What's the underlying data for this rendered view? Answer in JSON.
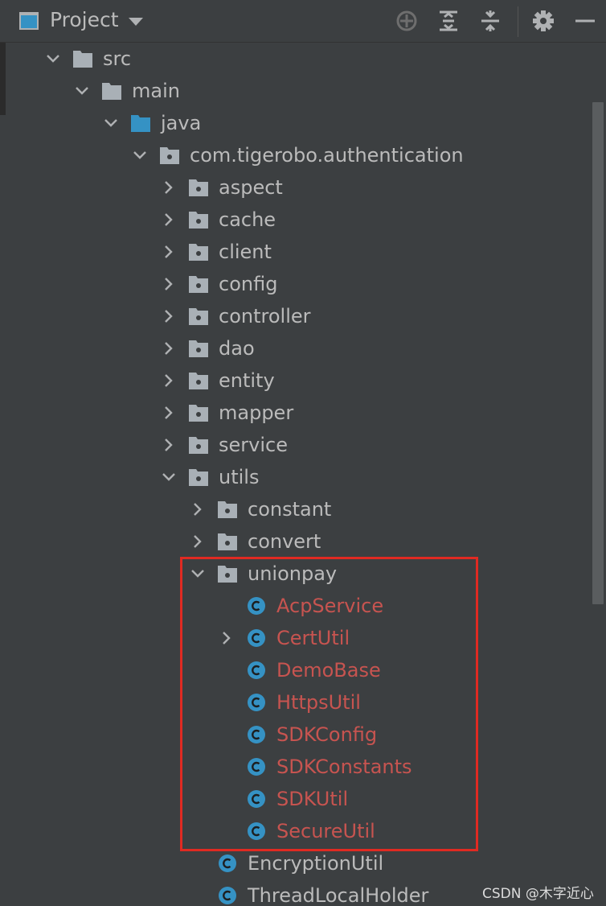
{
  "header": {
    "title": "Project",
    "icons": [
      "project-icon",
      "dropdown-icon",
      "locate-icon",
      "expand-all-icon",
      "collapse-all-icon",
      "gear-icon",
      "minimize-icon"
    ]
  },
  "tree": [
    {
      "label": "src",
      "depth": 0,
      "kind": "folder-gray",
      "arrow": "down"
    },
    {
      "label": "main",
      "depth": 1,
      "kind": "folder-gray",
      "arrow": "down"
    },
    {
      "label": "java",
      "depth": 2,
      "kind": "folder-blue",
      "arrow": "down"
    },
    {
      "label": "com.tigerobo.authentication",
      "depth": 3,
      "kind": "package",
      "arrow": "down"
    },
    {
      "label": "aspect",
      "depth": 4,
      "kind": "package",
      "arrow": "right"
    },
    {
      "label": "cache",
      "depth": 4,
      "kind": "package",
      "arrow": "right"
    },
    {
      "label": "client",
      "depth": 4,
      "kind": "package",
      "arrow": "right"
    },
    {
      "label": "config",
      "depth": 4,
      "kind": "package",
      "arrow": "right"
    },
    {
      "label": "controller",
      "depth": 4,
      "kind": "package",
      "arrow": "right"
    },
    {
      "label": "dao",
      "depth": 4,
      "kind": "package",
      "arrow": "right"
    },
    {
      "label": "entity",
      "depth": 4,
      "kind": "package",
      "arrow": "right"
    },
    {
      "label": "mapper",
      "depth": 4,
      "kind": "package",
      "arrow": "right"
    },
    {
      "label": "service",
      "depth": 4,
      "kind": "package",
      "arrow": "right"
    },
    {
      "label": "utils",
      "depth": 4,
      "kind": "package",
      "arrow": "down"
    },
    {
      "label": "constant",
      "depth": 5,
      "kind": "package",
      "arrow": "right"
    },
    {
      "label": "convert",
      "depth": 5,
      "kind": "package",
      "arrow": "right"
    },
    {
      "label": "unionpay",
      "depth": 5,
      "kind": "package",
      "arrow": "down"
    },
    {
      "label": "AcpService",
      "depth": 6,
      "kind": "class",
      "arrow": "none",
      "red": true
    },
    {
      "label": "CertUtil",
      "depth": 6,
      "kind": "class",
      "arrow": "right",
      "red": true
    },
    {
      "label": "DemoBase",
      "depth": 6,
      "kind": "class",
      "arrow": "none",
      "red": true
    },
    {
      "label": "HttpsUtil",
      "depth": 6,
      "kind": "class",
      "arrow": "none",
      "red": true
    },
    {
      "label": "SDKConfig",
      "depth": 6,
      "kind": "class",
      "arrow": "none",
      "red": true
    },
    {
      "label": "SDKConstants",
      "depth": 6,
      "kind": "class",
      "arrow": "none",
      "red": true
    },
    {
      "label": "SDKUtil",
      "depth": 6,
      "kind": "class",
      "arrow": "none",
      "red": true
    },
    {
      "label": "SecureUtil",
      "depth": 6,
      "kind": "class",
      "arrow": "none",
      "red": true
    },
    {
      "label": "EncryptionUtil",
      "depth": 5,
      "kind": "class",
      "arrow": "none"
    },
    {
      "label": "ThreadLocalHolder",
      "depth": 5,
      "kind": "class",
      "arrow": "none"
    }
  ],
  "colors": {
    "background": "#3c3f41",
    "text": "#bbbbbb",
    "modified_text": "#c75450",
    "class_icon": "#3592c4",
    "highlight_border": "#e02a22"
  },
  "watermark": "CSDN @木字近心"
}
